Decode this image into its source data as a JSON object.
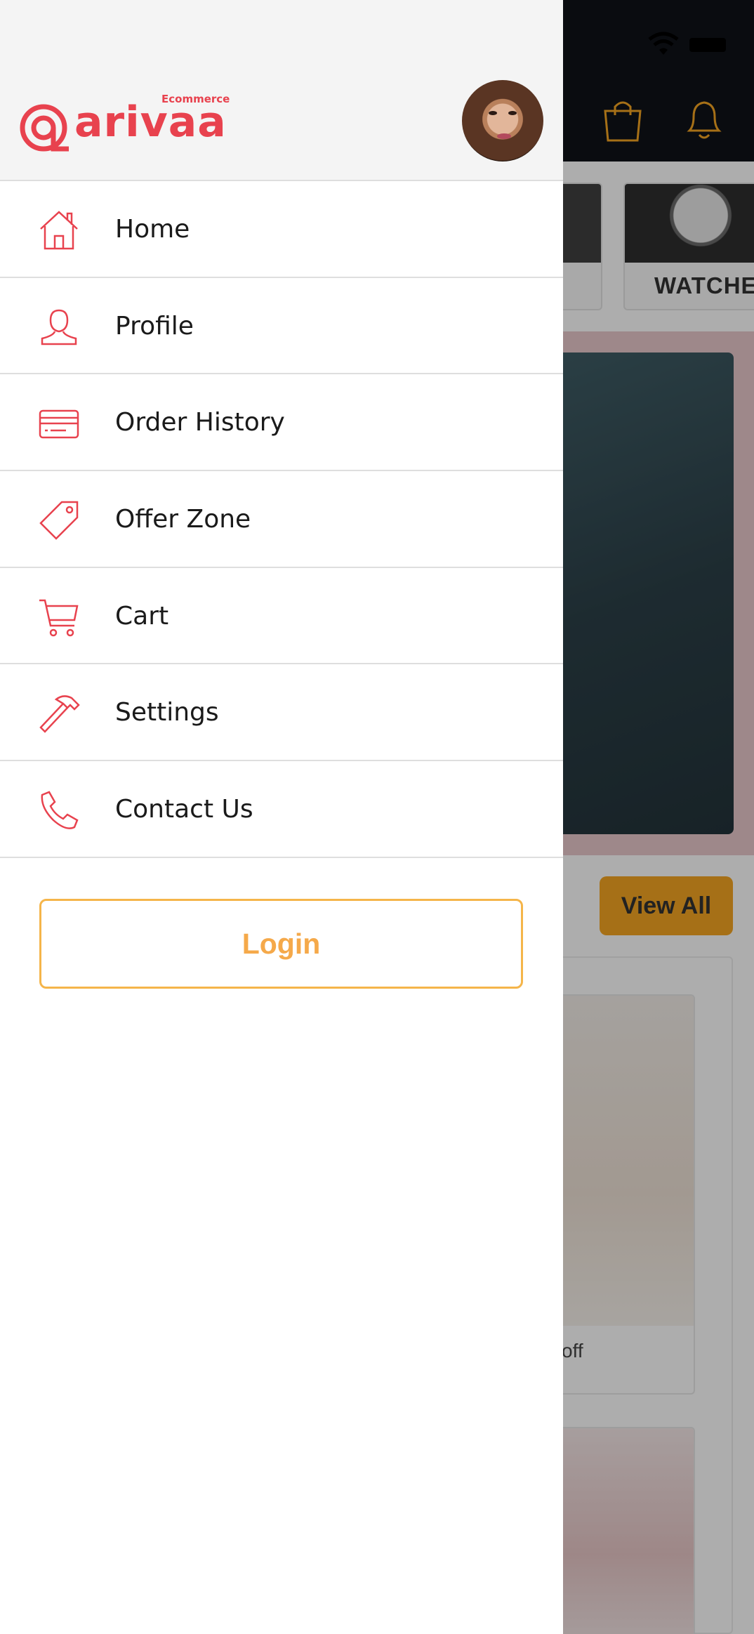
{
  "background": {
    "categories": [
      {
        "label": ""
      },
      {
        "label": "WATCHES"
      }
    ],
    "view_all_label": "View All",
    "product_text": "off",
    "icons": [
      "wifi-icon",
      "battery-icon",
      "shopping-bag-icon",
      "bell-icon"
    ]
  },
  "drawer": {
    "logo": {
      "word": "arivaa",
      "tag": "Ecommerce"
    },
    "menu_items": [
      {
        "label": "Home",
        "icon": "home-icon"
      },
      {
        "label": "Profile",
        "icon": "profile-icon"
      },
      {
        "label": "Order History",
        "icon": "credit-card-icon"
      },
      {
        "label": "Offer Zone",
        "icon": "tag-icon"
      },
      {
        "label": "Cart",
        "icon": "cart-icon"
      },
      {
        "label": "Settings",
        "icon": "hammer-icon"
      },
      {
        "label": "Contact Us",
        "icon": "phone-icon"
      }
    ],
    "login_label": "Login"
  },
  "colors": {
    "brand_red": "#e8424e",
    "accent_orange": "#f5a623",
    "login_border": "#f5b54a"
  }
}
